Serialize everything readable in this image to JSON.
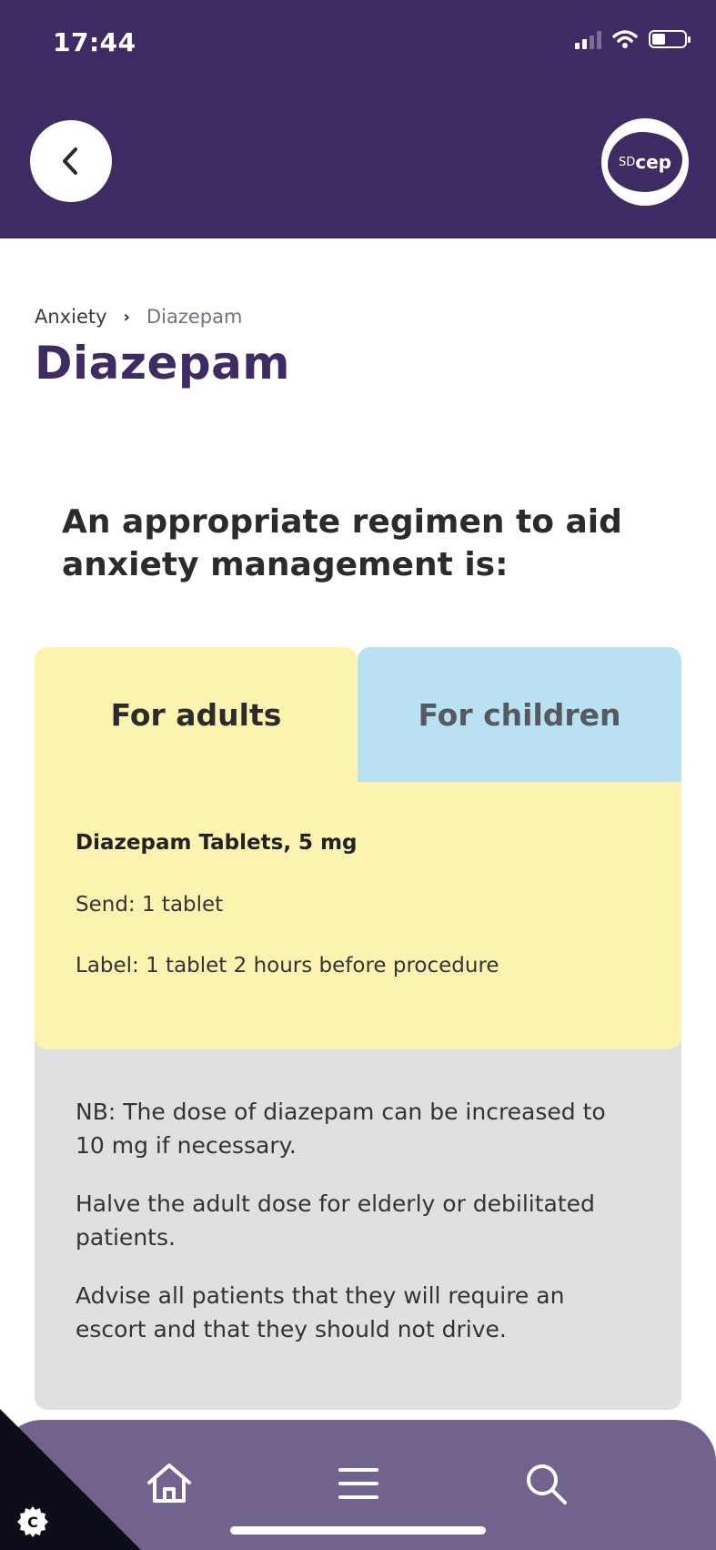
{
  "status_bar": {
    "time": "17:44"
  },
  "header": {
    "back_icon": "chevron-left-icon",
    "logo": "SDcep"
  },
  "breadcrumb": {
    "items": [
      "Anxiety",
      "Diazepam"
    ]
  },
  "page": {
    "title": "Diazepam",
    "intro": "An appropriate regimen to aid anxiety management is:"
  },
  "tabs": [
    {
      "label": "For adults",
      "selected": true
    },
    {
      "label": "For children",
      "selected": false
    }
  ],
  "regimen": {
    "name": "Diazepam Tablets, 5 mg",
    "send": "Send: 1 tablet",
    "label": "Label: 1 tablet 2 hours before procedure"
  },
  "notes": [
    "NB:   The dose of diazepam can be increased to 10 mg if necessary.",
    "Halve the adult dose for elderly or debilitated patients.",
    "Advise all patients that they will require an escort and that they should not drive."
  ],
  "bottom_nav": {
    "items": [
      "home-icon",
      "menu-icon",
      "search-icon"
    ]
  },
  "cookie_button": {
    "icon": "cookie-icon",
    "letter": "C"
  },
  "colors": {
    "brand_purple": "#3f2b63",
    "nav_purple": "#72628e",
    "adults_tab": "#fdf3b0",
    "children_tab": "#b9e0f3",
    "notes_bg": "#e0e0e3"
  }
}
